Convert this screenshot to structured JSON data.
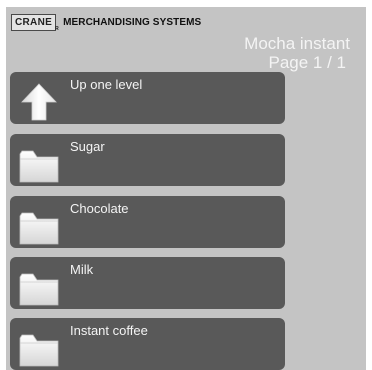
{
  "brand": {
    "logo": "CRANE",
    "registered": "R",
    "name": "MERCHANDISING SYSTEMS"
  },
  "header": {
    "title": "Mocha instant",
    "page": "Page 1 / 1"
  },
  "menu": {
    "items": [
      {
        "label": "Up one level",
        "icon": "arrow-up-icon"
      },
      {
        "label": "Sugar",
        "icon": "folder-icon"
      },
      {
        "label": "Chocolate",
        "icon": "folder-icon"
      },
      {
        "label": "Milk",
        "icon": "folder-icon"
      },
      {
        "label": "Instant coffee",
        "icon": "folder-icon"
      }
    ]
  },
  "colors": {
    "screen_background": "#c4c4c4",
    "button_background": "#595959",
    "text_light": "#f4f4f4"
  }
}
